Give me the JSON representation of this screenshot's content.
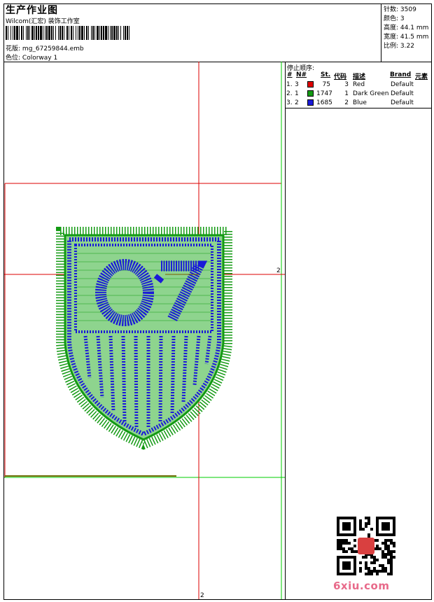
{
  "header": {
    "title": "生产作业图",
    "software": "Wilcom(汇宏) 装饰工作室",
    "design_label": "花版:",
    "design_file": "mg_67259844.emb",
    "colorway_label": "色位:",
    "colorway_name": "Colorway 1"
  },
  "stats": [
    {
      "label": "针数:",
      "value": "3509"
    },
    {
      "label": "颜色:",
      "value": "3"
    },
    {
      "label": "高度:",
      "value": "44.1 mm"
    },
    {
      "label": "宽度:",
      "value": "41.5 mm"
    },
    {
      "label": "比例:",
      "value": "3.22"
    }
  ],
  "stop_sequence": {
    "heading": "停止顺序:",
    "columns": [
      "#",
      "N#",
      "St.",
      "代码",
      "描述",
      "Brand",
      "元素"
    ],
    "rows": [
      {
        "index": "1.",
        "n": "3",
        "color": "#e00000",
        "stitches": "75",
        "code": "3",
        "desc": "Red",
        "brand": "Default"
      },
      {
        "index": "2.",
        "n": "1",
        "color": "#139a13",
        "stitches": "1747",
        "code": "1",
        "desc": "Dark Green",
        "brand": "Default"
      },
      {
        "index": "3.",
        "n": "2",
        "color": "#1a1ad8",
        "stitches": "1685",
        "code": "2",
        "desc": "Blue",
        "brand": "Default"
      }
    ]
  },
  "canvas": {
    "guide_labels": [
      "2",
      "2"
    ],
    "colors": {
      "guide_red": "#dd0000",
      "guide_green": "#00cc00",
      "thread_green": "#139a13",
      "thread_blue": "#1a1ad8",
      "fill_green": "#8ed48e"
    }
  },
  "watermark": "6xiu.com"
}
